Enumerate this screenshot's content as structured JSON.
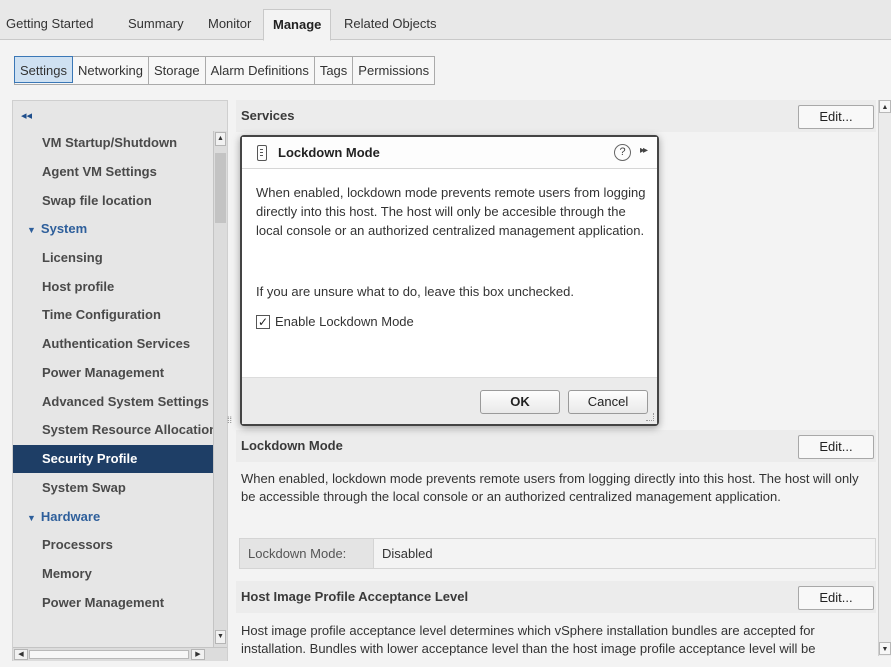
{
  "top_tabs": [
    {
      "label": "Getting Started"
    },
    {
      "label": "Summary"
    },
    {
      "label": "Monitor"
    },
    {
      "label": "Manage",
      "active": true
    },
    {
      "label": "Related Objects"
    }
  ],
  "sub_tabs": [
    {
      "label": "Settings",
      "active": true
    },
    {
      "label": "Networking"
    },
    {
      "label": "Storage"
    },
    {
      "label": "Alarm Definitions"
    },
    {
      "label": "Tags"
    },
    {
      "label": "Permissions"
    }
  ],
  "sidebar": {
    "collapse_glyph": "◂◂",
    "items": [
      {
        "label": "VM Startup/Shutdown",
        "kind": "child"
      },
      {
        "label": "Agent VM Settings",
        "kind": "child"
      },
      {
        "label": "Swap file location",
        "kind": "child"
      },
      {
        "label": "System",
        "kind": "group"
      },
      {
        "label": "Licensing",
        "kind": "child"
      },
      {
        "label": "Host profile",
        "kind": "child"
      },
      {
        "label": "Time Configuration",
        "kind": "child"
      },
      {
        "label": "Authentication Services",
        "kind": "child"
      },
      {
        "label": "Power Management",
        "kind": "child"
      },
      {
        "label": "Advanced System Settings",
        "kind": "child"
      },
      {
        "label": "System Resource Allocation",
        "kind": "child"
      },
      {
        "label": "Security Profile",
        "kind": "child",
        "selected": true
      },
      {
        "label": "System Swap",
        "kind": "child"
      },
      {
        "label": "Hardware",
        "kind": "group"
      },
      {
        "label": "Processors",
        "kind": "child"
      },
      {
        "label": "Memory",
        "kind": "child"
      },
      {
        "label": "Power Management",
        "kind": "child"
      }
    ]
  },
  "main": {
    "services_header": "Services",
    "edit_label": "Edit...",
    "lockdown_header": "Lockdown Mode",
    "lockdown_desc": "When enabled, lockdown mode prevents remote users from logging directly into this host. The host will only be accessible through the local console or an authorized centralized management application.",
    "lockdown_key": "Lockdown Mode:",
    "lockdown_value": "Disabled",
    "acceptance_header": "Host Image Profile Acceptance Level",
    "acceptance_desc": "Host image profile acceptance level determines which vSphere installation bundles are accepted for installation. Bundles with lower acceptance level than the host image profile acceptance level will be"
  },
  "dialog": {
    "title": "Lockdown Mode",
    "help_glyph": "?",
    "expand_glyph": "▸▸",
    "body": "When enabled, lockdown mode prevents remote users from logging directly into this host. The host will only be accesible through the local console or an authorized centralized management application.",
    "note": "If you are unsure what to do, leave this box unchecked.",
    "checkbox_label": "Enable Lockdown Mode",
    "checkbox_checked": true,
    "ok_label": "OK",
    "cancel_label": "Cancel"
  },
  "colors": {
    "selected_nav_bg": "#1e3e66",
    "active_subtab_bg": "#cfe1f2",
    "group_label": "#2e5f9b"
  }
}
